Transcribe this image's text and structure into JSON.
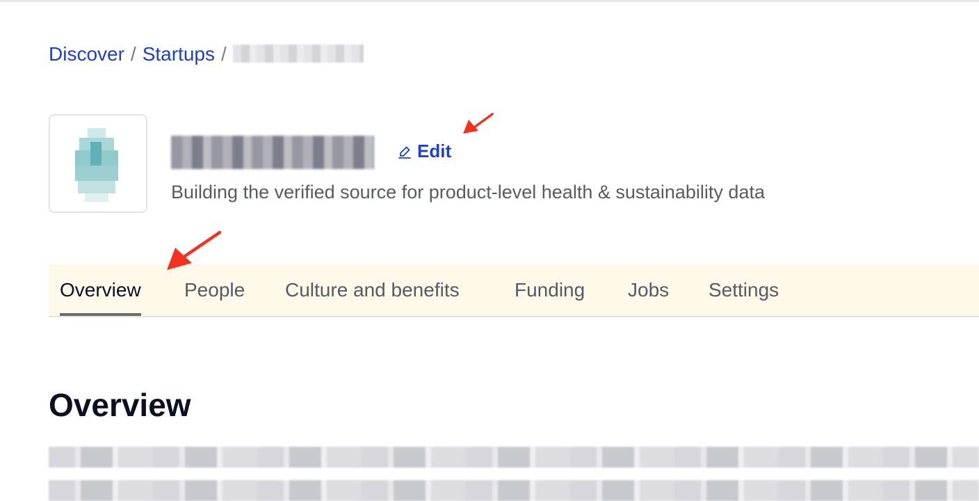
{
  "breadcrumb": {
    "items": [
      {
        "label": "Discover"
      },
      {
        "label": "Startups"
      }
    ],
    "separator": "/"
  },
  "company": {
    "edit_label": "Edit",
    "tagline": "Building the verified source for product-level health & sustainability data"
  },
  "tabs": [
    {
      "label": "Overview",
      "active": true
    },
    {
      "label": "People",
      "active": false
    },
    {
      "label": "Culture and benefits",
      "active": false
    },
    {
      "label": "Funding",
      "active": false
    },
    {
      "label": "Jobs",
      "active": false
    },
    {
      "label": "Settings",
      "active": false
    }
  ],
  "overview": {
    "title": "Overview"
  },
  "icons": {
    "edit": "pencil-icon",
    "annotation": "red-arrow"
  },
  "colors": {
    "link": "#1c3fcc",
    "tab_bar_bg": "#fef9e8",
    "heading": "#0b1123",
    "muted": "#555a66",
    "annotation": "#f2321f"
  }
}
